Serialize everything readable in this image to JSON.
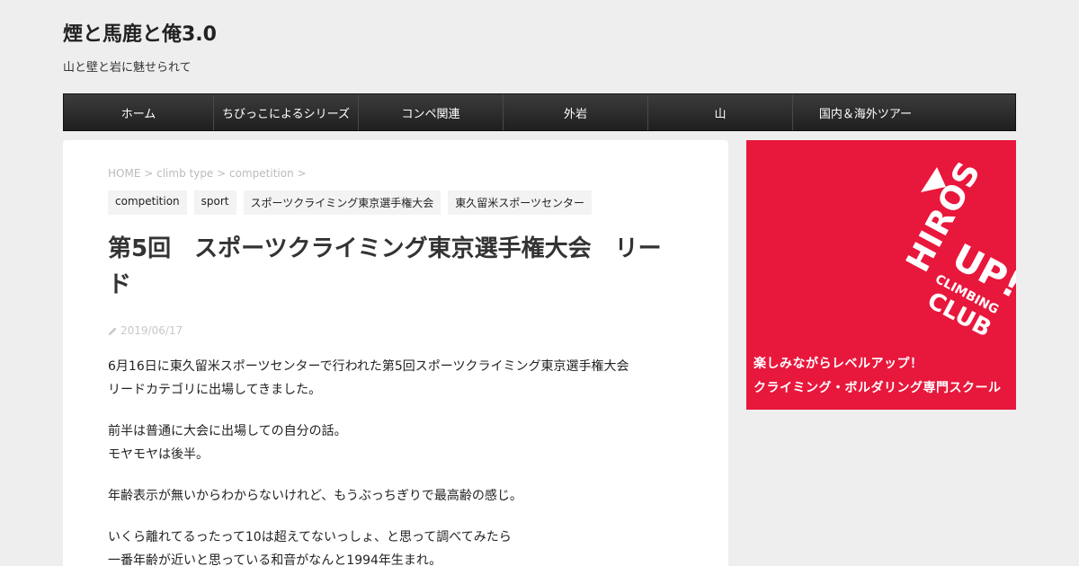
{
  "site": {
    "title": "煙と馬鹿と俺3.0",
    "description": "山と壁と岩に魅せられて"
  },
  "nav": {
    "items": [
      {
        "label": "ホーム"
      },
      {
        "label": "ちびっこによるシリーズ"
      },
      {
        "label": "コンペ関連"
      },
      {
        "label": "外岩"
      },
      {
        "label": "山"
      },
      {
        "label": "国内＆海外ツアー"
      }
    ]
  },
  "breadcrumb": {
    "home": "HOME",
    "sep": ">",
    "level1": "climb type",
    "level2": "competition"
  },
  "tags": [
    {
      "label": "competition"
    },
    {
      "label": "sport"
    },
    {
      "label": "スポーツクライミング東京選手権大会"
    },
    {
      "label": "東久留米スポーツセンター"
    }
  ],
  "post": {
    "title": "第5回　スポーツクライミング東京選手権大会　リード",
    "date": "2019/06/17",
    "paragraphs": [
      {
        "line1": "6月16日に東久留米スポーツセンターで行われた第5回スポーツクライミング東京選手権大会",
        "line2": "リードカテゴリに出場してきました。"
      },
      {
        "line1": "前半は普通に大会に出場しての自分の話。",
        "line2": "モヤモヤは後半。"
      },
      {
        "line1": "年齢表示が無いからわからないけれど、もうぶっちぎりで最高齢の感じ。",
        "line2": ""
      },
      {
        "line1": "いくら離れてるったって10は超えてないっしょ、と思って調べてみたら",
        "line2": "一番年齢が近いと思っている和音がなんと1994年生まれ。"
      }
    ]
  },
  "ad": {
    "logo_text": "HIROS UP! CLIMBING CLUB",
    "line1": "楽しみながらレベルアップ！",
    "line2": "クライミング・ボルダリング専門スクール",
    "bg_color": "#e8173c"
  }
}
